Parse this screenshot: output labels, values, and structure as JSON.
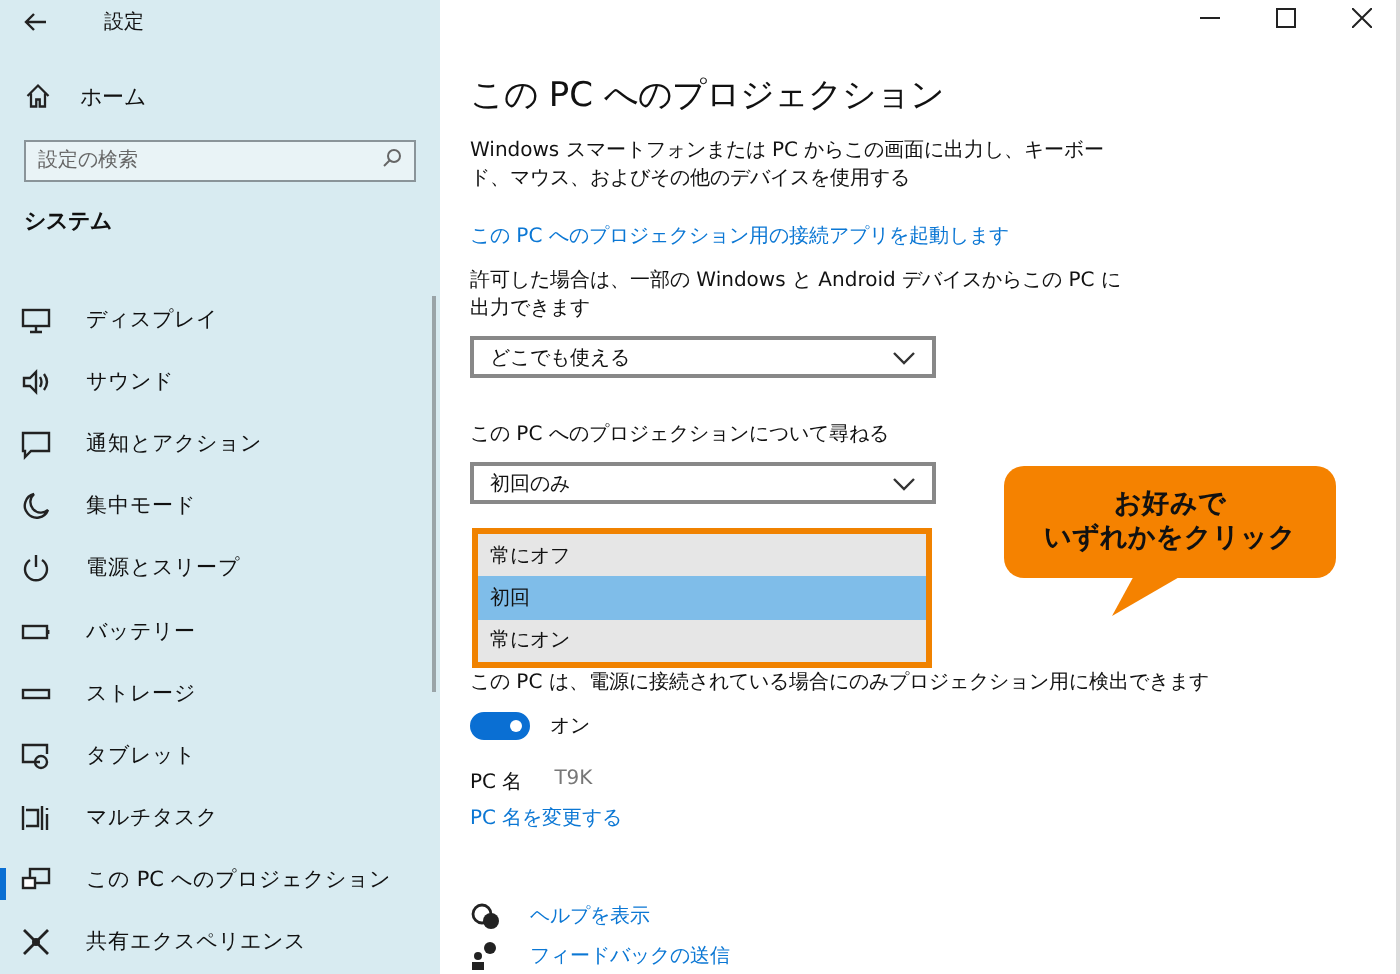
{
  "window": {
    "title": "設定"
  },
  "sidebar": {
    "home": "ホーム",
    "search": {
      "placeholder": "設定の検索"
    },
    "section": "システム",
    "items": [
      {
        "label": "ディスプレイ",
        "kind": "display",
        "selected": false
      },
      {
        "label": "サウンド",
        "kind": "sound",
        "selected": false
      },
      {
        "label": "通知とアクション",
        "kind": "notification",
        "selected": false
      },
      {
        "label": "集中モード",
        "kind": "moon",
        "selected": false
      },
      {
        "label": "電源とスリープ",
        "kind": "power",
        "selected": false
      },
      {
        "label": "バッテリー",
        "kind": "battery",
        "selected": false
      },
      {
        "label": "ストレージ",
        "kind": "storage",
        "selected": false
      },
      {
        "label": "タブレット",
        "kind": "tablet",
        "selected": false
      },
      {
        "label": "マルチタスク",
        "kind": "multitask",
        "selected": false
      },
      {
        "label": "この PC へのプロジェクション",
        "kind": "projection",
        "selected": true
      },
      {
        "label": "共有エクスペリエンス",
        "kind": "shared",
        "selected": false
      }
    ]
  },
  "main": {
    "title": "この PC へのプロジェクション",
    "description": "Windows スマートフォンまたは PC からこの画面に出力し、キーボード、マウス、およびその他のデバイスを使用する",
    "launch_link": "この PC へのプロジェクション用の接続アプリを起動します",
    "permission_label": "許可した場合は、一部の Windows と Android デバイスからこの PC に出力できます",
    "permission_dropdown": {
      "value": "どこでも使える"
    },
    "ask_label": "この PC へのプロジェクションについて尋ねる",
    "ask_dropdown": {
      "value": "初回のみ",
      "options": [
        {
          "label": "常にオフ",
          "selected": false
        },
        {
          "label": "初回",
          "selected": true
        },
        {
          "label": "常にオン",
          "selected": false
        }
      ]
    },
    "power_text": "この PC は、電源に接続されている場合にのみプロジェクション用に検出できます",
    "toggle": {
      "on": true,
      "label": "オン"
    },
    "pc_name_label": "PC 名",
    "pc_name_value": "T9K",
    "rename_link": "PC 名を変更する",
    "help_links": [
      {
        "kind": "help",
        "label": "ヘルプを表示"
      },
      {
        "kind": "feedback",
        "label": "フィードバックの送信"
      }
    ]
  },
  "callout": {
    "lines": [
      "お好みで",
      "いずれかをクリック"
    ]
  }
}
